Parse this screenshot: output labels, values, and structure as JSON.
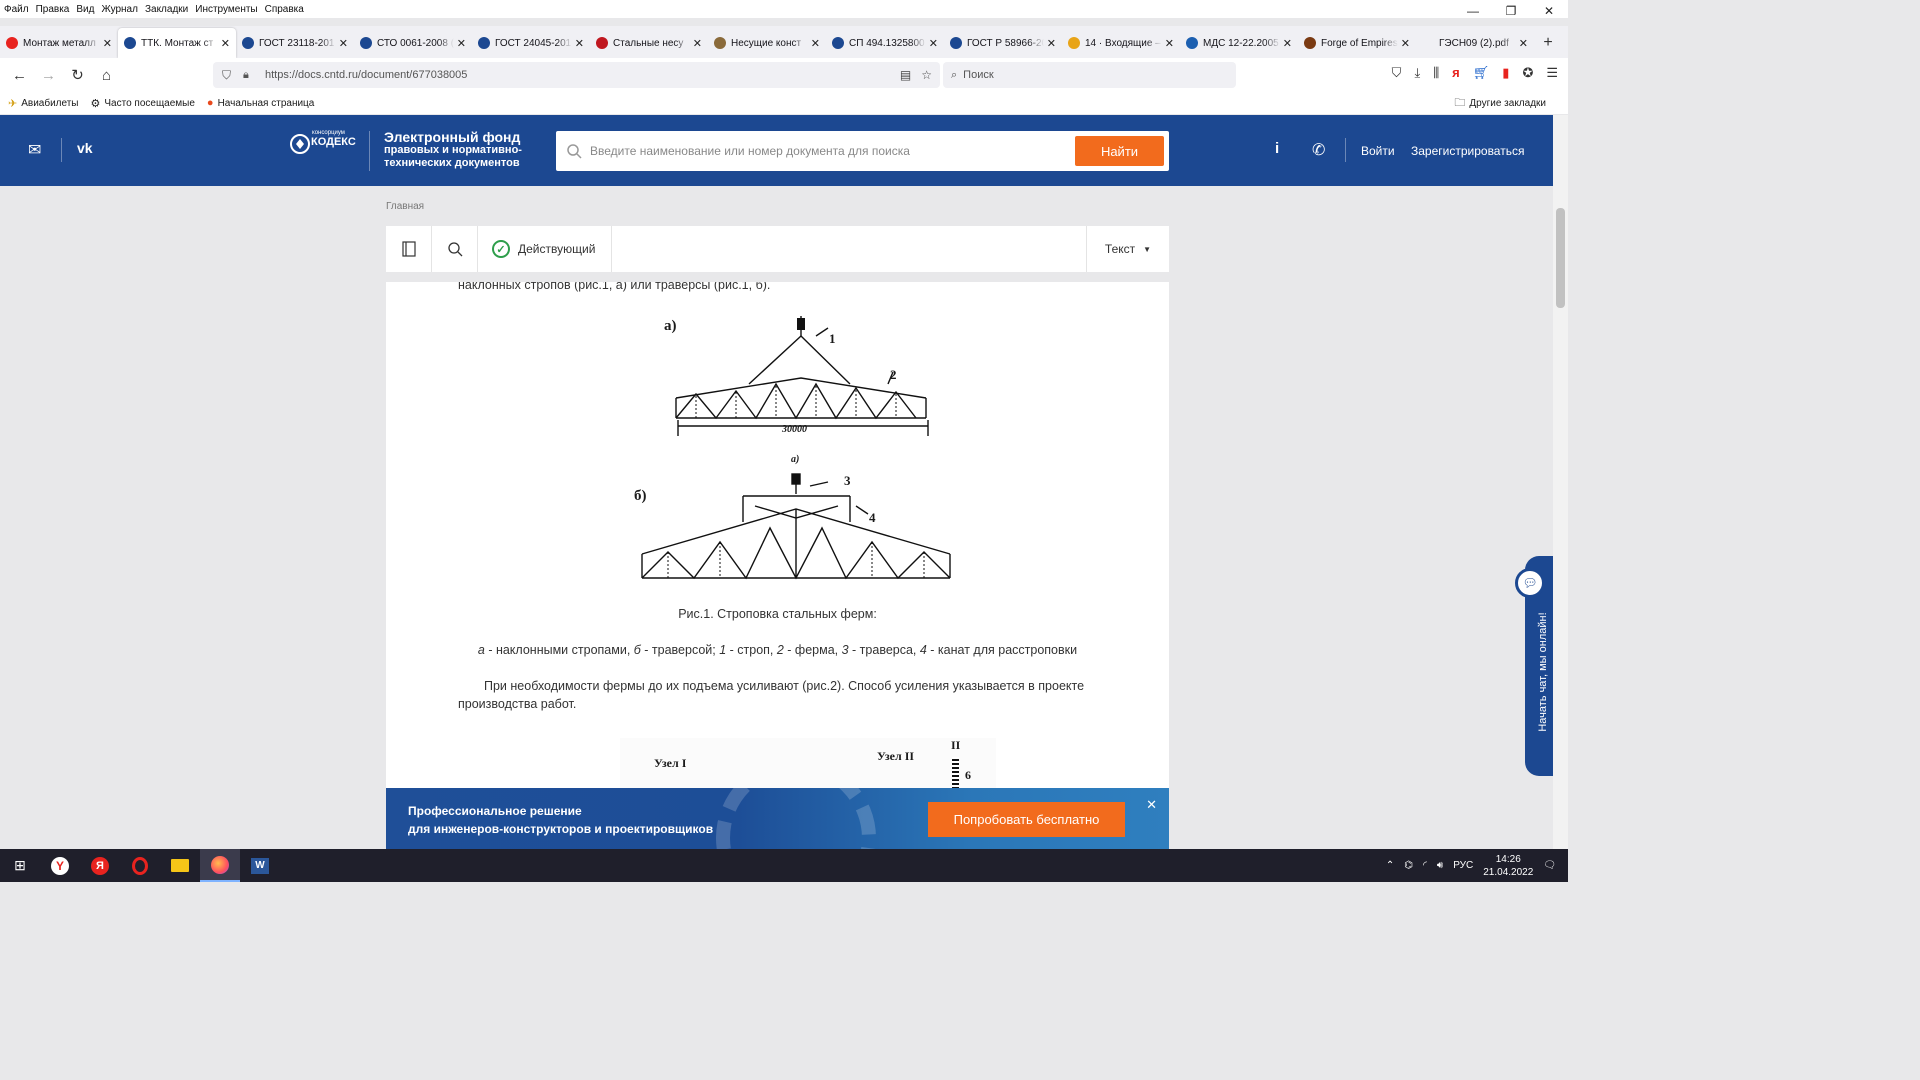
{
  "menubar": [
    "Файл",
    "Правка",
    "Вид",
    "Журнал",
    "Закладки",
    "Инструменты",
    "Справка"
  ],
  "tabs": [
    {
      "label": "Монтаж металл",
      "icon": "yandex-icon",
      "color": "#e8231f"
    },
    {
      "label": "ТТК. Монтаж ст",
      "icon": "kodeks-icon",
      "color": "#1c4891",
      "active": true
    },
    {
      "label": "ГОСТ 23118-201",
      "icon": "kodeks-icon",
      "color": "#1c4891"
    },
    {
      "label": "СТО 0061-2008 (",
      "icon": "kodeks-icon",
      "color": "#1c4891"
    },
    {
      "label": "ГОСТ 24045-201",
      "icon": "kodeks-icon",
      "color": "#1c4891"
    },
    {
      "label": "Стальные несу",
      "icon": "l-icon",
      "color": "#c0171f"
    },
    {
      "label": "Несущие конст",
      "icon": "crane-icon",
      "color": "#8a6a3a"
    },
    {
      "label": "СП 494.1325800",
      "icon": "kodeks-icon",
      "color": "#1c4891"
    },
    {
      "label": "ГОСТ Р 58966-20",
      "icon": "kodeks-icon",
      "color": "#1c4891"
    },
    {
      "label": "14 · Входящие –",
      "icon": "mail-icon",
      "color": "#e8a418"
    },
    {
      "label": "МДС 12-22.2005",
      "icon": "cloud-icon",
      "color": "#1c5fb0"
    },
    {
      "label": "Forge of Empires",
      "icon": "foe-icon",
      "color": "#7a3a12"
    },
    {
      "label": "ГЭСН09 (2).pdf",
      "icon": "pdf-icon",
      "color": "#f0f0f4"
    }
  ],
  "url": "https://docs.cntd.ru/document/677038005",
  "search_placeholder": "Поиск",
  "bookmarks": [
    {
      "label": "Авиабилеты",
      "icon": "plane-icon"
    },
    {
      "label": "Часто посещаемые",
      "icon": "gear-icon"
    },
    {
      "label": "Начальная страница",
      "icon": "firefox-icon"
    }
  ],
  "other_bookmarks": "Другие закладки",
  "site": {
    "brand_title": "Электронный фонд",
    "brand_line2": "правовых и нормативно-",
    "brand_line3": "технических документов",
    "logo_small": "консорциум",
    "logo_main": "КОДЕКС",
    "search_placeholder": "Введите наименование или номер документа для поиска",
    "find_button": "Найти",
    "login": "Войти",
    "register": "Зарегистрироваться"
  },
  "breadcrumb": "Главная",
  "doc_toolbar": {
    "status": "Действующий",
    "view_mode": "Текст"
  },
  "document": {
    "intro_line": "наклонных стропов (рис.1, а) или траверсы (рис.1, б).",
    "fig1_label_a": "а)",
    "fig1_label_b": "б)",
    "fig1_label_a_small": "а)",
    "fig1_span": "30000",
    "fig1_numbers": [
      "1",
      "2",
      "3",
      "4"
    ],
    "fig1_caption": "Рис.1. Строповка стальных ферм:",
    "legend_a_letter": "а",
    "legend_a_text": " - наклонными стропами, ",
    "legend_b_letter": "б",
    "legend_b_text": " - траверсой; ",
    "legend_1": "1",
    "legend_1_text": " - строп, ",
    "legend_2": "2",
    "legend_2_text": " - ферма, ",
    "legend_3": "3",
    "legend_3_text": " - траверса, ",
    "legend_4": "4",
    "legend_4_text": " - канат для расстроповки",
    "paragraph_1": "При необходимости фермы до их подъема усиливают (рис.2). Способ усиления указывается в проекте",
    "paragraph_2": "производства работ.",
    "fig2_node1": "Узел I",
    "fig2_node2": "Узел II",
    "fig2_roman": "II",
    "fig2_num": "6"
  },
  "promo": {
    "line1": "Профессиональное решение",
    "line2": "для инженеров-конструкторов и проектировщиков",
    "button": "Попробовать бесплатно"
  },
  "chat_label": "Начать чат, мы онлайн!",
  "taskbar": {
    "lang": "РУС",
    "time": "14:26",
    "date": "21.04.2022"
  }
}
